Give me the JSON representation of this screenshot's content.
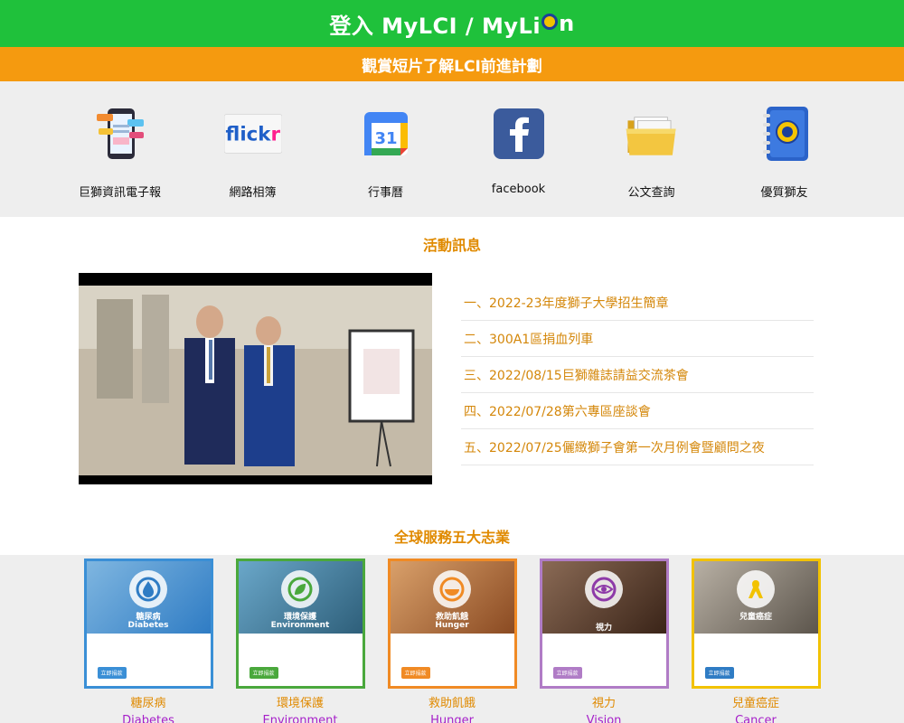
{
  "header": {
    "login_prefix": "登入 MyLCI / MyLi",
    "login_suffix": "n"
  },
  "banner": {
    "label": "觀賞短片了解LCI前進計劃"
  },
  "quick_links": [
    {
      "label": "巨獅資訊電子報",
      "icon": "newsletter-phone-icon"
    },
    {
      "label": "網路相簿",
      "icon": "flickr-logo-icon"
    },
    {
      "label": "行事曆",
      "icon": "calendar-31-icon"
    },
    {
      "label": "facebook",
      "icon": "facebook-logo-icon"
    },
    {
      "label": "公文查詢",
      "icon": "folders-icon"
    },
    {
      "label": "優質獅友",
      "icon": "lions-address-book-icon"
    }
  ],
  "calendar_day": "31",
  "flickr_text": {
    "part1": "flick",
    "part2": "r"
  },
  "events": {
    "title": "活動訊息",
    "items": [
      "一、2022-23年度獅子大學招生簡章",
      "二、300A1區捐血列車",
      "三、2022/08/15巨獅雜誌請益交流茶會",
      "四、2022/07/28第六專區座談會",
      "五、2022/07/25儷緻獅子會第一次月例會暨顧問之夜"
    ]
  },
  "causes": {
    "title": "全球服務五大志業",
    "button_label": "立即捐款",
    "items": [
      {
        "zh": "糖尿病",
        "en": "Diabetes",
        "color": "#3a8fd6"
      },
      {
        "zh": "環境保護",
        "en": "Environment",
        "color": "#4aa83c"
      },
      {
        "zh": "救助飢餓",
        "en": "Hunger",
        "color": "#f08a24"
      },
      {
        "zh": "視力",
        "en": "Vision",
        "color": "#b07cc6"
      },
      {
        "zh": "兒童癌症",
        "en": "Cancer",
        "color": "#f2c200"
      }
    ]
  },
  "colors": {
    "green": "#1fc13b",
    "orange": "#f59a0f",
    "title_gold": "#e08a00",
    "cause_en_purple": "#a61fc9"
  }
}
